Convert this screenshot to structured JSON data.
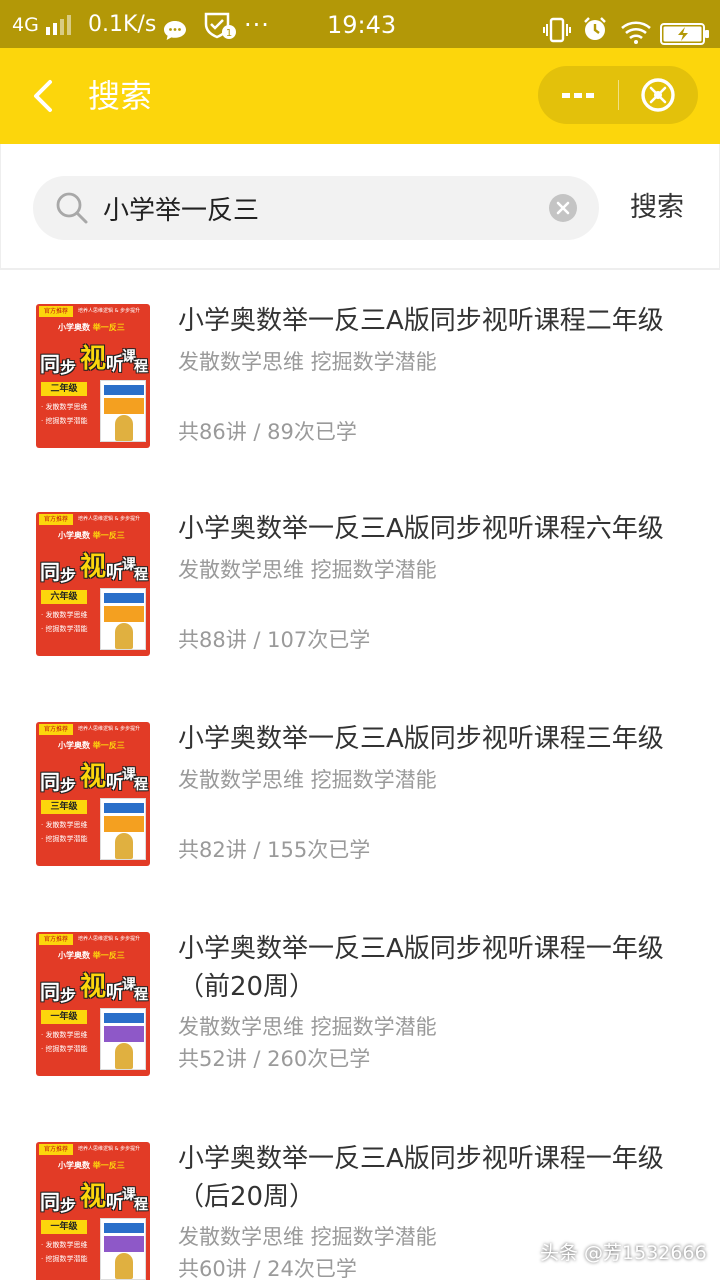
{
  "status_bar": {
    "network": "4G",
    "speed": "0.1K/s",
    "more": "···",
    "time": "19:43"
  },
  "header": {
    "title": "搜索",
    "capsule_more_icon": "more-dots-icon",
    "capsule_close_icon": "close-circle-icon"
  },
  "search": {
    "query": "小学举一反三",
    "button_label": "搜索"
  },
  "cover": {
    "top_left": "官方推荐",
    "top_right": "培养人思维逻辑 & 步步提升",
    "subtitle_prefix": "小学奥数",
    "subtitle_highlight": "举一反三",
    "big_1": "同",
    "big_2": "步",
    "big_3": "视",
    "big_4": "听",
    "big_5": "课",
    "big_6": "程",
    "line_1": "· 发散数学思维",
    "line_2": "· 挖掘数学潜能"
  },
  "courses": [
    {
      "title": "小学奥数举一反三A版同步视听课程二年级",
      "desc": "发散数学思维 挖掘数学潜能",
      "meta": "共86讲 / 89次已学",
      "grade": "二年级"
    },
    {
      "title": "小学奥数举一反三A版同步视听课程六年级",
      "desc": "发散数学思维 挖掘数学潜能",
      "meta": "共88讲 / 107次已学",
      "grade": "六年级"
    },
    {
      "title": "小学奥数举一反三A版同步视听课程三年级",
      "desc": "发散数学思维 挖掘数学潜能",
      "meta": "共82讲 / 155次已学",
      "grade": "三年级"
    },
    {
      "title": "小学奥数举一反三A版同步视听课程一年级（前20周）",
      "desc": "发散数学思维 挖掘数学潜能",
      "meta": "共52讲 / 260次已学",
      "grade": "一年级"
    },
    {
      "title": "小学奥数举一反三A版同步视听课程一年级（后20周）",
      "desc": "发散数学思维 挖掘数学潜能",
      "meta": "共60讲 / 24次已学",
      "grade": "一年级"
    }
  ],
  "watermark": "头条 @芳1532666",
  "colors": {
    "status_bar": "#b39807",
    "header": "#fcd60c",
    "capsule": "#e3c10b",
    "cover_red": "#e23b26",
    "muted_text": "#9a9a9a"
  }
}
